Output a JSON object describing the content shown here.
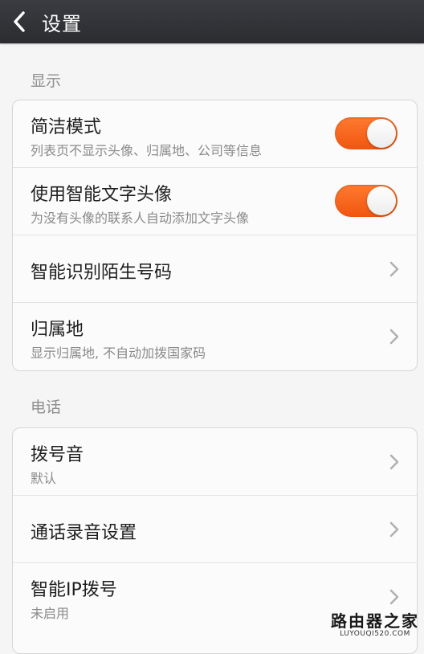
{
  "header": {
    "title": "设置"
  },
  "sections": [
    {
      "label": "显示",
      "items": [
        {
          "title": "简洁模式",
          "subtitle": "列表页不显示头像、归属地、公司等信息",
          "control": "toggle",
          "on": true
        },
        {
          "title": "使用智能文字头像",
          "subtitle": "为没有头像的联系人自动添加文字头像",
          "control": "toggle",
          "on": true
        },
        {
          "title": "智能识别陌生号码",
          "control": "chevron"
        },
        {
          "title": "归属地",
          "subtitle": "显示归属地, 不自动加拨国家码",
          "control": "chevron"
        }
      ]
    },
    {
      "label": "电话",
      "items": [
        {
          "title": "拨号音",
          "subtitle": "默认",
          "control": "chevron"
        },
        {
          "title": "通话录音设置",
          "control": "chevron"
        },
        {
          "title": "智能IP拨号",
          "subtitle": "未启用",
          "control": "chevron"
        }
      ]
    }
  ],
  "watermark": {
    "main": "路由器之家",
    "sub": "LUYOUQI520.COM"
  },
  "colors": {
    "toggle_on": "#f0560f",
    "header_bg": "#2b2c30",
    "background": "#f5f5f5"
  },
  "icons": {
    "back": "chevron-left-icon",
    "row_arrow": "chevron-right-icon"
  }
}
